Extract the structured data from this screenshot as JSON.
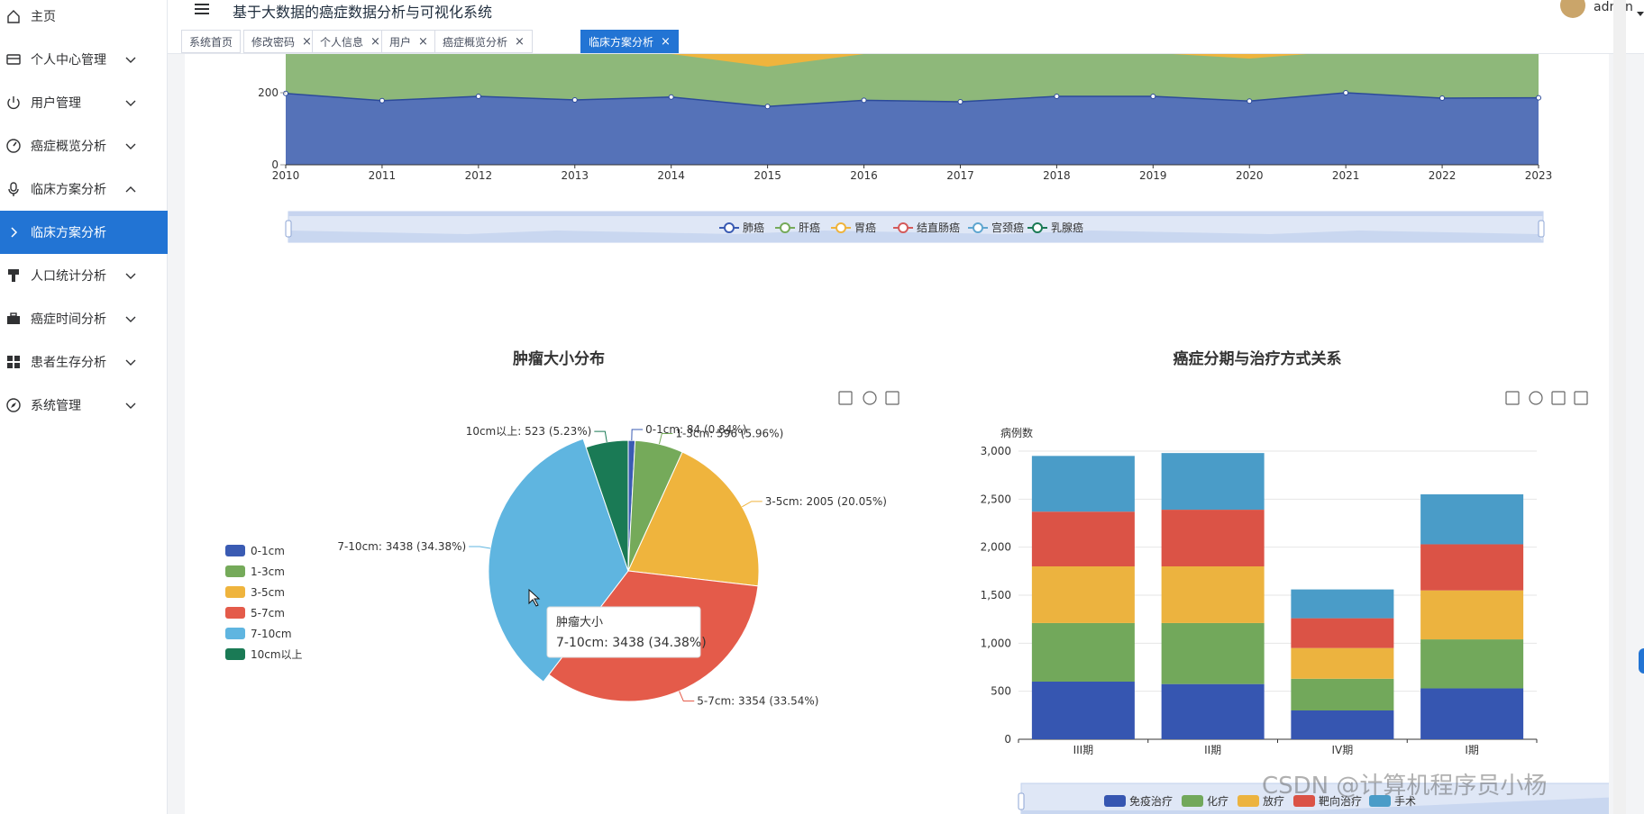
{
  "app": {
    "title": "基于大数据的癌症数据分析与可视化系统",
    "user": "admin"
  },
  "sidebar": {
    "items": [
      {
        "label": "主页",
        "icon": "home-icon",
        "arrow": ""
      },
      {
        "label": "个人中心管理",
        "icon": "card-icon",
        "arrow": "down"
      },
      {
        "label": "用户管理",
        "icon": "power-icon",
        "arrow": "down"
      },
      {
        "label": "癌症概览分析",
        "icon": "gauge-icon",
        "arrow": "down"
      },
      {
        "label": "临床方案分析",
        "icon": "microphone-icon",
        "arrow": "up"
      },
      {
        "label": "临床方案分析",
        "icon": "chevron-right-icon",
        "arrow": "",
        "active": true
      },
      {
        "label": "人口统计分析",
        "icon": "brush-icon",
        "arrow": "down"
      },
      {
        "label": "癌症时间分析",
        "icon": "briefcase-icon",
        "arrow": "down"
      },
      {
        "label": "患者生存分析",
        "icon": "grid-icon",
        "arrow": "down"
      },
      {
        "label": "系统管理",
        "icon": "compass-icon",
        "arrow": "down"
      }
    ]
  },
  "tabs": [
    {
      "label": "系统首页",
      "closable": false,
      "active": false
    },
    {
      "label": "修改密码",
      "closable": true,
      "active": false
    },
    {
      "label": "个人信息",
      "closable": true,
      "active": false
    },
    {
      "label": "用户",
      "closable": true,
      "active": false
    },
    {
      "label": "癌症概览分析",
      "closable": true,
      "active": false
    },
    {
      "label": "临床方案分析",
      "closable": true,
      "active": true
    }
  ],
  "close_glyph": "×",
  "watermark": "CSDN @计算机程序员小杨",
  "colors": {
    "accent": "#2274d4",
    "series": [
      "#3a5bb3",
      "#75aa5a",
      "#efb43d",
      "#e45b4a",
      "#5fb5e0",
      "#1a7a55"
    ],
    "stack": [
      "#3656b1",
      "#72a85b",
      "#ecb33f",
      "#db5346",
      "#4a9cc8"
    ]
  },
  "chart_data": [
    {
      "type": "area",
      "x": [
        "2010",
        "2011",
        "2012",
        "2013",
        "2014",
        "2015",
        "2016",
        "2017",
        "2018",
        "2019",
        "2020",
        "2021",
        "2022",
        "2023"
      ],
      "y_ticks": [
        "0",
        "200"
      ],
      "ylim": [
        0,
        300
      ],
      "series": [
        {
          "name": "肺癌",
          "values": [
            198,
            178,
            190,
            180,
            188,
            162,
            179,
            175,
            190,
            190,
            177,
            200,
            185,
            186
          ]
        }
      ],
      "legend": [
        "肺癌",
        "肝癌",
        "胃癌",
        "结直肠癌",
        "宫颈癌",
        "乳腺癌"
      ],
      "legend_position": "bottom"
    },
    {
      "type": "pie",
      "title": "肿瘤大小分布",
      "categories": [
        "0-1cm",
        "1-3cm",
        "3-5cm",
        "5-7cm",
        "7-10cm",
        "10cm以上"
      ],
      "values": [
        84,
        596,
        2005,
        3354,
        3438,
        523
      ],
      "labels": [
        "0-1cm: 84 (0.84%)",
        "1-3cm: 596 (5.96%)",
        "3-5cm: 2005 (20.05%)",
        "5-7cm: 3354 (33.54%)",
        "7-10cm: 3438 (34.38%)",
        "10cm以上: 523 (5.23%)"
      ],
      "legend_position": "left",
      "tooltip": {
        "title": "肿瘤大小",
        "text": "7-10cm: 3438 (34.38%)"
      }
    },
    {
      "type": "bar",
      "title": "癌症分期与治疗方式关系",
      "ylabel": "病例数",
      "categories": [
        "III期",
        "II期",
        "IV期",
        "I期"
      ],
      "y_ticks": [
        "0",
        "500",
        "1,000",
        "1,500",
        "2,000",
        "2,500",
        "3,000"
      ],
      "ylim": [
        0,
        3000
      ],
      "series": [
        {
          "name": "免疫治疗",
          "values": [
            600,
            575,
            300,
            530
          ]
        },
        {
          "name": "化疗",
          "values": [
            610,
            635,
            330,
            510
          ]
        },
        {
          "name": "放疗",
          "values": [
            590,
            590,
            320,
            510
          ]
        },
        {
          "name": "靶向治疗",
          "values": [
            570,
            590,
            310,
            480
          ]
        },
        {
          "name": "手术",
          "values": [
            580,
            590,
            300,
            520
          ]
        }
      ],
      "legend_position": "bottom"
    }
  ]
}
